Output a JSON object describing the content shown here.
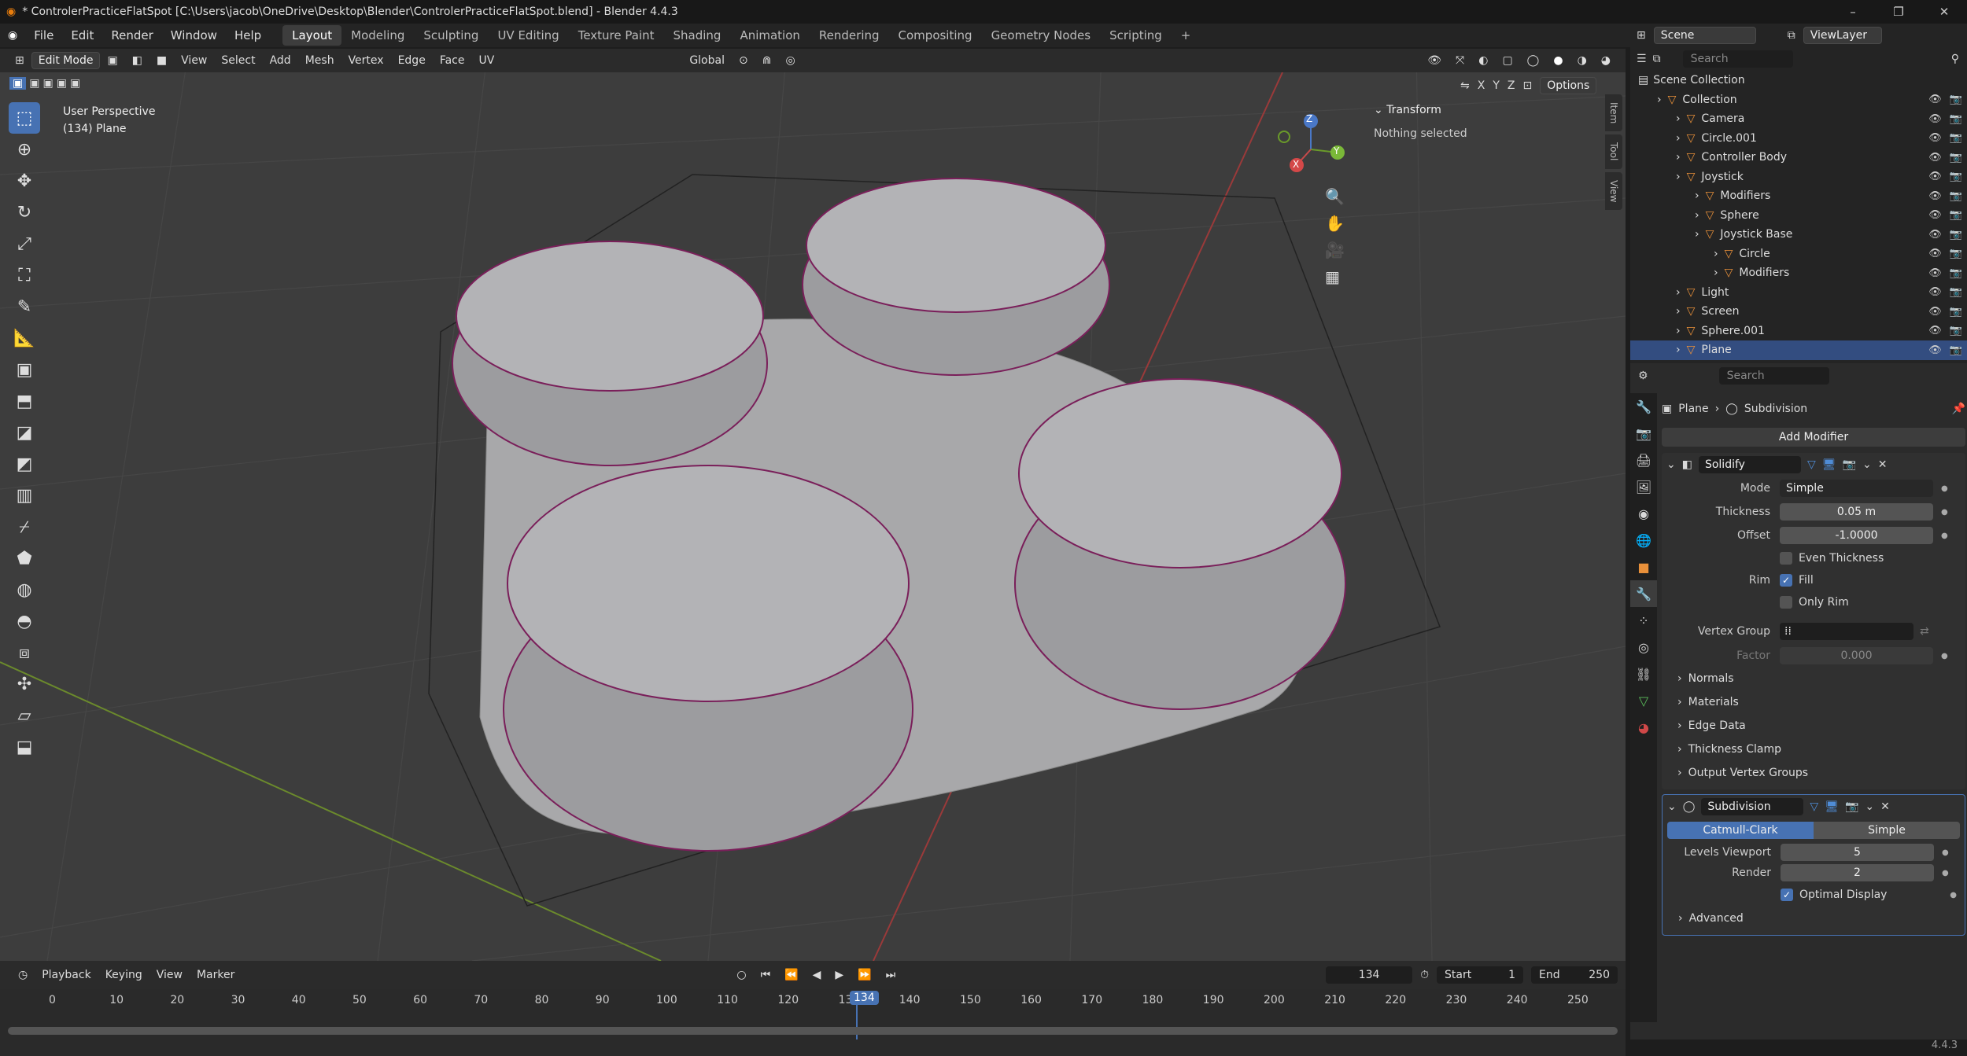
{
  "window": {
    "title": "* ControlerPracticeFlatSpot [C:\\Users\\jacob\\OneDrive\\Desktop\\Blender\\ControlerPracticeFlatSpot.blend] - Blender 4.4.3"
  },
  "topbar": {
    "menus": [
      "File",
      "Edit",
      "Render",
      "Window",
      "Help"
    ],
    "workspaces": [
      "Layout",
      "Modeling",
      "Sculpting",
      "UV Editing",
      "Texture Paint",
      "Shading",
      "Animation",
      "Rendering",
      "Compositing",
      "Geometry Nodes",
      "Scripting"
    ],
    "active_workspace": "Layout",
    "scene": "Scene",
    "view_layer": "ViewLayer"
  },
  "viewport_header": {
    "mode": "Edit Mode",
    "menus": [
      "View",
      "Select",
      "Add",
      "Mesh",
      "Vertex",
      "Edge",
      "Face",
      "UV"
    ],
    "orientation": "Global",
    "options": "Options",
    "axes": [
      "X",
      "Y",
      "Z"
    ]
  },
  "viewport": {
    "perspective": "User Perspective",
    "object_info": "(134) Plane",
    "gizmo_axes": [
      "X",
      "Y",
      "Z"
    ]
  },
  "npanel": {
    "section": "Transform",
    "status": "Nothing selected",
    "tabs": [
      "Item",
      "Tool",
      "View"
    ]
  },
  "timeline": {
    "menus": [
      "Playback",
      "Keying",
      "View",
      "Marker"
    ],
    "current_frame": "134",
    "start_label": "Start",
    "start": "1",
    "end_label": "End",
    "end": "250",
    "ticks": [
      "0",
      "10",
      "20",
      "30",
      "40",
      "50",
      "60",
      "70",
      "80",
      "90",
      "100",
      "110",
      "120",
      "130",
      "140",
      "150",
      "160",
      "170",
      "180",
      "190",
      "200",
      "210",
      "220",
      "230",
      "240",
      "250"
    ]
  },
  "outliner": {
    "search_placeholder": "Search",
    "root": "Scene Collection",
    "items": [
      {
        "label": "Collection",
        "indent": 1,
        "selected": false
      },
      {
        "label": "Camera",
        "indent": 2,
        "selected": false
      },
      {
        "label": "Circle.001",
        "indent": 2,
        "selected": false
      },
      {
        "label": "Controller Body",
        "indent": 2,
        "selected": false
      },
      {
        "label": "Joystick",
        "indent": 2,
        "selected": false
      },
      {
        "label": "Modifiers",
        "indent": 3,
        "selected": false
      },
      {
        "label": "Sphere",
        "indent": 3,
        "selected": false
      },
      {
        "label": "Joystick Base",
        "indent": 3,
        "selected": false
      },
      {
        "label": "Circle",
        "indent": 4,
        "selected": false
      },
      {
        "label": "Modifiers",
        "indent": 4,
        "selected": false
      },
      {
        "label": "Light",
        "indent": 2,
        "selected": false
      },
      {
        "label": "Screen",
        "indent": 2,
        "selected": false
      },
      {
        "label": "Sphere.001",
        "indent": 2,
        "selected": false
      },
      {
        "label": "Plane",
        "indent": 2,
        "selected": true
      }
    ]
  },
  "properties": {
    "search_placeholder": "Search",
    "breadcrumb_object": "Plane",
    "breadcrumb_modifier": "Subdivision",
    "add_modifier": "Add Modifier",
    "solidify": {
      "name": "Solidify",
      "mode_label": "Mode",
      "mode": "Simple",
      "thickness_label": "Thickness",
      "thickness": "0.05 m",
      "offset_label": "Offset",
      "offset": "-1.0000",
      "even_thickness": "Even Thickness",
      "rim_label": "Rim",
      "fill": "Fill",
      "only_rim": "Only Rim",
      "vertex_group_label": "Vertex Group",
      "factor_label": "Factor",
      "factor": "0.000",
      "subpanels": [
        "Normals",
        "Materials",
        "Edge Data",
        "Thickness Clamp",
        "Output Vertex Groups"
      ]
    },
    "subdivision": {
      "name": "Subdivision",
      "type_a": "Catmull-Clark",
      "type_b": "Simple",
      "levels_viewport_label": "Levels Viewport",
      "levels_viewport": "5",
      "render_label": "Render",
      "render": "2",
      "optimal_display": "Optimal Display",
      "advanced": "Advanced"
    }
  },
  "statusbar": {
    "version": "4.4.3"
  }
}
